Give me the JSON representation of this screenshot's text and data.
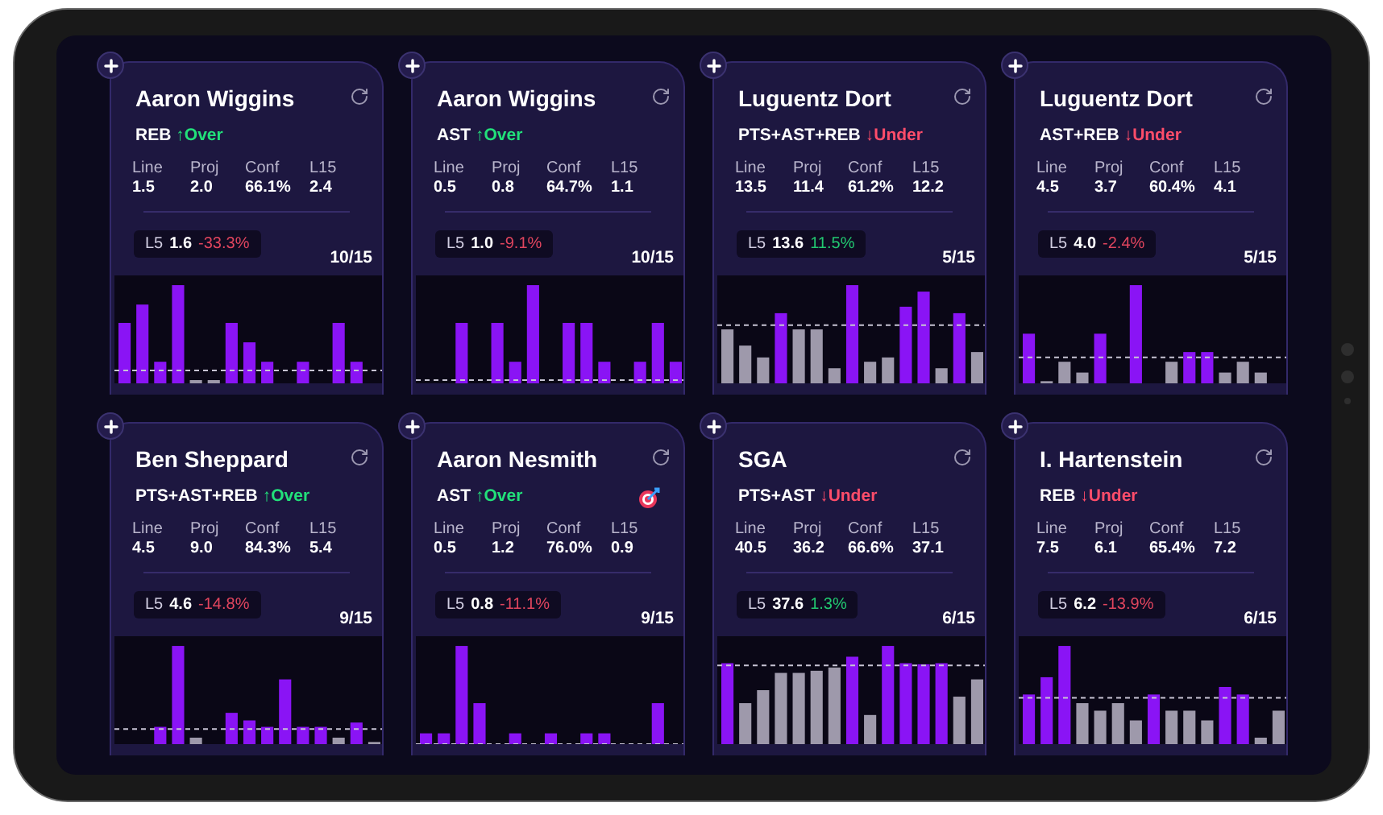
{
  "cards": [
    {
      "name": "Aaron Wiggins",
      "market": "REB",
      "pick": {
        "text": "↑Over",
        "color": "#22e07a"
      },
      "targeted": false,
      "stats": [
        {
          "label": "Line",
          "value": "1.5"
        },
        {
          "label": "Proj",
          "value": "2.0"
        },
        {
          "label": "Conf",
          "value": "66.1%"
        },
        {
          "label": "L15",
          "value": "2.4"
        }
      ],
      "l5": {
        "label": "L5",
        "value": "1.6",
        "change": "-33.3%",
        "color": "#e0455e"
      },
      "record": "10/15"
    },
    {
      "name": "Aaron Wiggins",
      "market": "AST",
      "pick": {
        "text": "↑Over",
        "color": "#22e07a"
      },
      "targeted": false,
      "stats": [
        {
          "label": "Line",
          "value": "0.5"
        },
        {
          "label": "Proj",
          "value": "0.8"
        },
        {
          "label": "Conf",
          "value": "64.7%"
        },
        {
          "label": "L15",
          "value": "1.1"
        }
      ],
      "l5": {
        "label": "L5",
        "value": "1.0",
        "change": "-9.1%",
        "color": "#e0455e"
      },
      "record": "10/15"
    },
    {
      "name": "Luguentz Dort",
      "market": "PTS+AST+REB",
      "pick": {
        "text": "↓Under",
        "color": "#ff4d6a"
      },
      "targeted": false,
      "stats": [
        {
          "label": "Line",
          "value": "13.5"
        },
        {
          "label": "Proj",
          "value": "11.4"
        },
        {
          "label": "Conf",
          "value": "61.2%"
        },
        {
          "label": "L15",
          "value": "12.2"
        }
      ],
      "l5": {
        "label": "L5",
        "value": "13.6",
        "change": "11.5%",
        "color": "#22c870"
      },
      "record": "5/15"
    },
    {
      "name": "Luguentz Dort",
      "market": "AST+REB",
      "pick": {
        "text": "↓Under",
        "color": "#ff4d6a"
      },
      "targeted": false,
      "stats": [
        {
          "label": "Line",
          "value": "4.5"
        },
        {
          "label": "Proj",
          "value": "3.7"
        },
        {
          "label": "Conf",
          "value": "60.4%"
        },
        {
          "label": "L15",
          "value": "4.1"
        }
      ],
      "l5": {
        "label": "L5",
        "value": "4.0",
        "change": "-2.4%",
        "color": "#e0455e"
      },
      "record": "5/15"
    },
    {
      "name": "Ben Sheppard",
      "market": "PTS+AST+REB",
      "pick": {
        "text": "↑Over",
        "color": "#22e07a"
      },
      "targeted": false,
      "stats": [
        {
          "label": "Line",
          "value": "4.5"
        },
        {
          "label": "Proj",
          "value": "9.0"
        },
        {
          "label": "Conf",
          "value": "84.3%"
        },
        {
          "label": "L15",
          "value": "5.4"
        }
      ],
      "l5": {
        "label": "L5",
        "value": "4.6",
        "change": "-14.8%",
        "color": "#e0455e"
      },
      "record": "9/15"
    },
    {
      "name": "Aaron Nesmith",
      "market": "AST",
      "pick": {
        "text": "↑Over",
        "color": "#22e07a"
      },
      "targeted": true,
      "stats": [
        {
          "label": "Line",
          "value": "0.5"
        },
        {
          "label": "Proj",
          "value": "1.2"
        },
        {
          "label": "Conf",
          "value": "76.0%"
        },
        {
          "label": "L15",
          "value": "0.9"
        }
      ],
      "l5": {
        "label": "L5",
        "value": "0.8",
        "change": "-11.1%",
        "color": "#e0455e"
      },
      "record": "9/15"
    },
    {
      "name": "SGA",
      "market": "PTS+AST",
      "pick": {
        "text": "↓Under",
        "color": "#ff4d6a"
      },
      "targeted": false,
      "stats": [
        {
          "label": "Line",
          "value": "40.5"
        },
        {
          "label": "Proj",
          "value": "36.2"
        },
        {
          "label": "Conf",
          "value": "66.6%"
        },
        {
          "label": "L15",
          "value": "37.1"
        }
      ],
      "l5": {
        "label": "L5",
        "value": "37.6",
        "change": "1.3%",
        "color": "#22c870"
      },
      "record": "6/15"
    },
    {
      "name": "I. Hartenstein",
      "market": "REB",
      "pick": {
        "text": "↓Under",
        "color": "#ff4d6a"
      },
      "targeted": false,
      "stats": [
        {
          "label": "Line",
          "value": "7.5"
        },
        {
          "label": "Proj",
          "value": "6.1"
        },
        {
          "label": "Conf",
          "value": "65.4%"
        },
        {
          "label": "L15",
          "value": "7.2"
        }
      ],
      "l5": {
        "label": "L5",
        "value": "6.2",
        "change": "-13.9%",
        "color": "#e0455e"
      },
      "record": "6/15"
    }
  ]
}
